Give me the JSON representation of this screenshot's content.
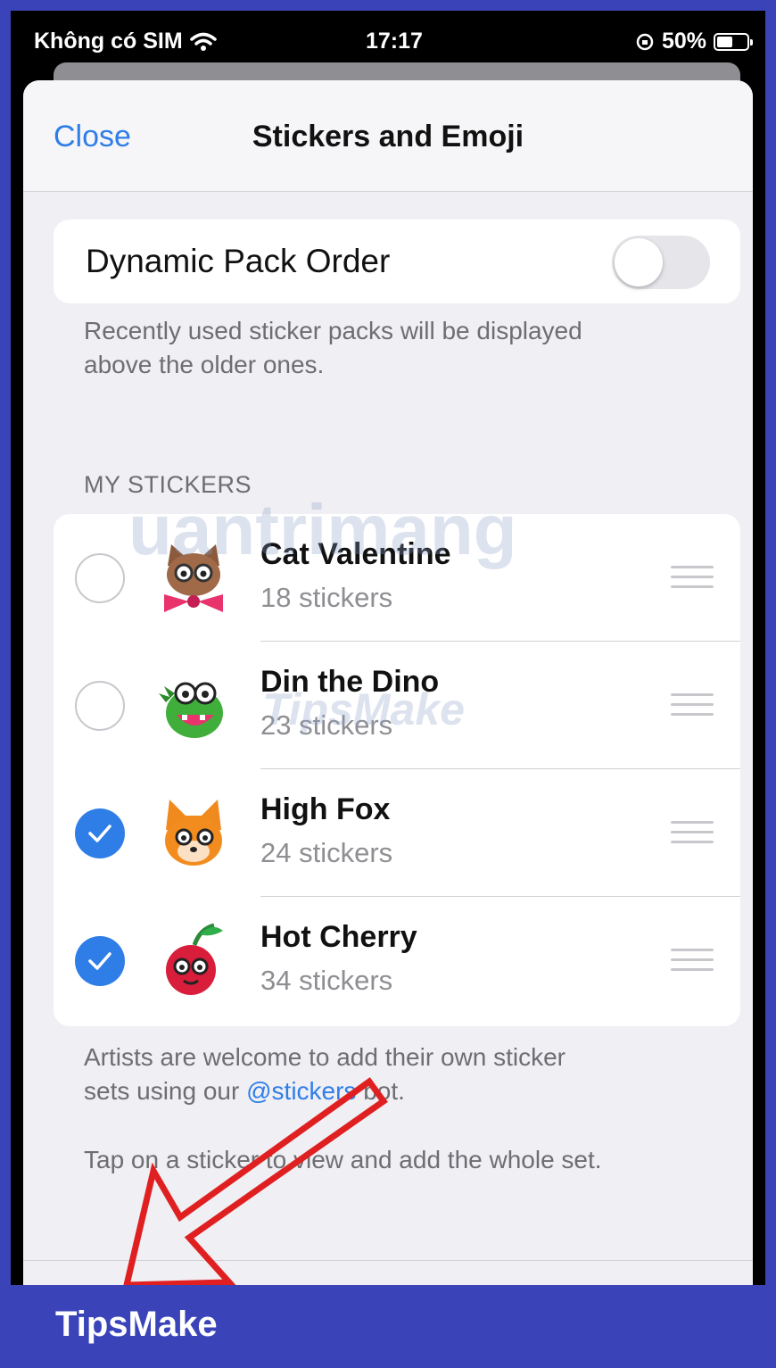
{
  "status_bar": {
    "carrier": "Không có SIM",
    "time": "17:17",
    "battery": "50%"
  },
  "nav": {
    "close_label": "Close",
    "title": "Stickers and Emoji"
  },
  "dynamic_pack": {
    "label": "Dynamic Pack Order",
    "enabled": false,
    "footnote_line1": "Recently used sticker packs will be displayed",
    "footnote_line2": "above the older ones."
  },
  "my_stickers": {
    "header": "MY STICKERS",
    "packs": [
      {
        "title": "Cat Valentine",
        "count": "18 stickers",
        "selected": false,
        "icon": "cat-sticker-icon"
      },
      {
        "title": "Din the Dino",
        "count": "23 stickers",
        "selected": false,
        "icon": "dino-sticker-icon"
      },
      {
        "title": "High Fox",
        "count": "24 stickers",
        "selected": true,
        "icon": "fox-sticker-icon"
      },
      {
        "title": "Hot Cherry",
        "count": "34 stickers",
        "selected": true,
        "icon": "cherry-sticker-icon"
      }
    ]
  },
  "footer": {
    "artists_line1": "Artists are welcome to add their own sticker",
    "artists_prefix": "sets using our ",
    "artists_link": "@stickers",
    "artists_suffix": " bot.",
    "tap_hint": "Tap on a sticker to view and add the whole set."
  },
  "watermark": {
    "text1": "uantrimang",
    "text2": "TipsMake"
  },
  "brand": "TipsMake",
  "colors": {
    "accent": "#2f7ee8",
    "frame": "#3a44b8",
    "annotation_arrow": "#e02020"
  }
}
